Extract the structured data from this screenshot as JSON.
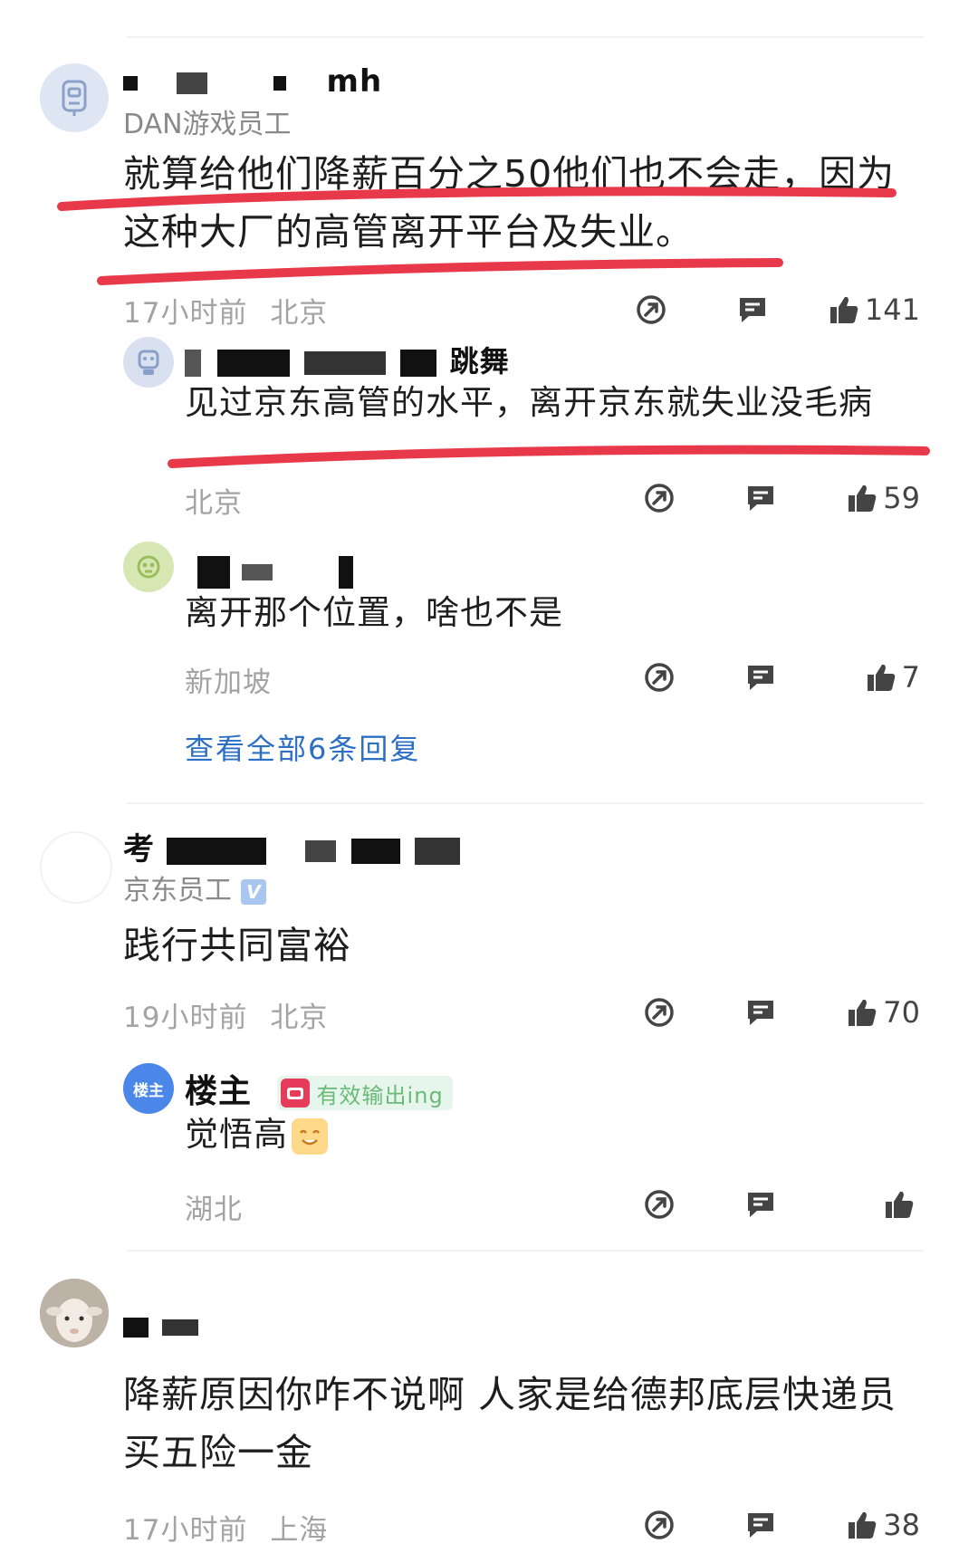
{
  "colors": {
    "link": "#2c6fc5",
    "meta": "#a3a3a3",
    "highlight_stroke": "#e8394a",
    "owner_avatar": "#4a87e8"
  },
  "comments": [
    {
      "name_visible": "mh",
      "tag": "DAN游戏员工",
      "text": "就算给他们降薪百分之50他们也不会走，因为这种大厂的高管离开平台及失业。",
      "time": "17小时前",
      "location": "北京",
      "likes": "141",
      "replies": [
        {
          "name_visible": "跳舞",
          "text": "见过京东高管的水平，离开京东就失业没毛病",
          "location": "北京",
          "likes": "59"
        },
        {
          "name_visible": "",
          "text": "离开那个位置，啥也不是",
          "location": "新加坡",
          "likes": "7"
        }
      ],
      "view_all": "查看全部6条回复"
    },
    {
      "name_visible": "考",
      "tag": "京东员工",
      "verified": "V",
      "text": "践行共同富裕",
      "time": "19小时前",
      "location": "北京",
      "likes": "70",
      "replies": [
        {
          "avatar_label": "楼主",
          "name": "楼主",
          "badge": "有效输出ing",
          "text": "觉悟高",
          "location": "湖北",
          "likes": ""
        }
      ]
    },
    {
      "name_visible": "",
      "text": "降薪原因你咋不说啊 人家是给德邦底层快递员买五险一金",
      "time": "17小时前",
      "location": "上海",
      "likes": "38"
    }
  ],
  "icons": {
    "share": "share-icon",
    "reply": "reply-icon",
    "like": "thumbs-up-icon"
  }
}
